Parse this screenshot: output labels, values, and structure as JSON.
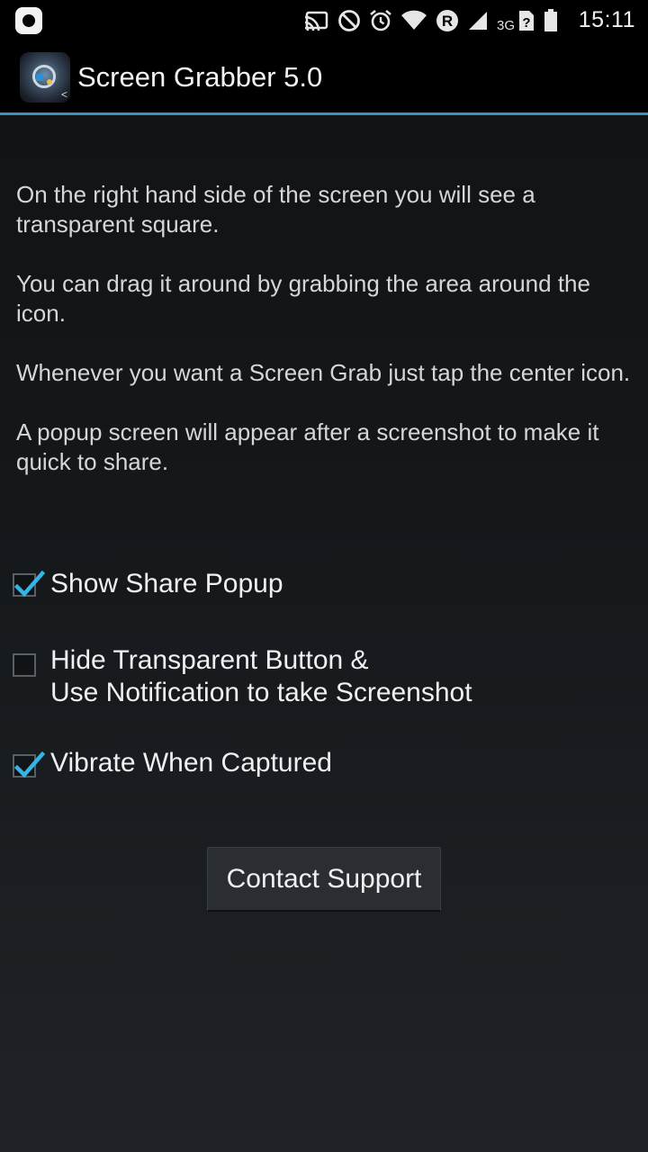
{
  "status_bar": {
    "time": "15:11",
    "network_label": "3G",
    "icons": [
      "app-notification-icon",
      "cast-icon",
      "do-not-disturb-icon",
      "alarm-icon",
      "wifi-icon",
      "roaming-icon",
      "signal-icon",
      "unknown-sim-icon",
      "battery-icon"
    ]
  },
  "action_bar": {
    "title": "Screen Grabber 5.0",
    "icon": "screen-grabber-app-icon",
    "divider_color": "#3f8fbf"
  },
  "instructions": [
    "On the right hand side of the screen you will see a transparent square.",
    "You can drag it around by grabbing the area around the icon.",
    "Whenever you want a Screen Grab just tap the center icon.",
    "A popup screen will appear after a screenshot to make it quick to share."
  ],
  "options": {
    "show_share_popup": {
      "label": "Show Share Popup",
      "checked": true
    },
    "hide_transparent_button": {
      "label_line1": "Hide Transparent Button &",
      "label_line2": "Use Notification to take Screenshot",
      "checked": false
    },
    "vibrate_when_captured": {
      "label": "Vibrate When Captured",
      "checked": true
    }
  },
  "contact_button": {
    "label": "Contact Support"
  },
  "colors": {
    "accent": "#33b5e5",
    "background_top": "#101215",
    "background_bottom": "#1f2327"
  }
}
